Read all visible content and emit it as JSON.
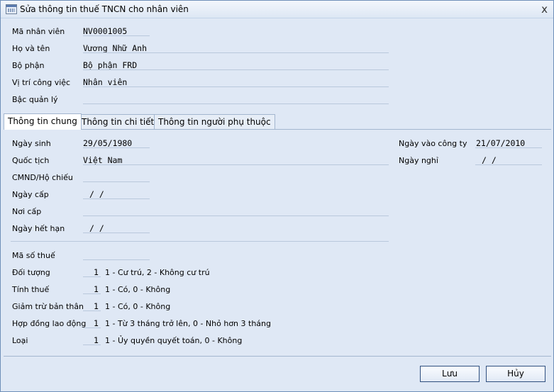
{
  "window": {
    "title": "Sửa thông tin thuế TNCN cho nhân viên",
    "close": "x"
  },
  "employee": {
    "code_label": "Mã nhân viên",
    "code": "NV0001005",
    "name_label": "Họ và tên",
    "name": "Vương Nhữ Anh",
    "dept_label": "Bộ phận",
    "dept": "Bộ phận FRD",
    "position_label": "Vị trí công việc",
    "position": "Nhân viên",
    "level_label": "Bậc quản lý",
    "level": ""
  },
  "tabs": [
    {
      "label": "Thông tin chung",
      "active": true
    },
    {
      "label": "Thông tin chi tiết",
      "active": false
    },
    {
      "label": "Thông tin người phụ thuộc",
      "active": false
    }
  ],
  "general": {
    "dob_label": "Ngày sinh",
    "dob": "29/05/1980",
    "nationality_label": "Quốc tịch",
    "nationality": "Việt Nam",
    "id_label": "CMND/Hộ chiếu",
    "id": "",
    "issue_date_label": "Ngày cấp",
    "issue_date": "/ /",
    "issue_place_label": "Nơi cấp",
    "issue_place": "",
    "expiry_label": "Ngày hết hạn",
    "expiry": "/ /",
    "join_date_label": "Ngày vào công ty",
    "join_date": "21/07/2010",
    "leave_date_label": "Ngày nghỉ",
    "leave_date": "/ /"
  },
  "tax": {
    "tax_code_label": "Mã số thuế",
    "tax_code": "",
    "subject_label": "Đối tượng",
    "subject": "1",
    "subject_hint": "1 - Cư trú, 2 - Không cư trú",
    "taxable_label": "Tính thuế",
    "taxable": "1",
    "taxable_hint": "1 - Có, 0 - Không",
    "self_deduct_label": "Giảm trừ bản thân",
    "self_deduct": "1",
    "self_deduct_hint": "1 - Có, 0 - Không",
    "contract_label": "Hợp đồng lao động",
    "contract": "1",
    "contract_hint": "1 - Từ 3 tháng trở lên, 0 - Nhỏ hơn 3 tháng",
    "type_label": "Loại",
    "type": "1",
    "type_hint": "1 - Ủy quyền quyết toán, 0 - Không"
  },
  "buttons": {
    "save": "Lưu",
    "cancel": "Hủy"
  }
}
